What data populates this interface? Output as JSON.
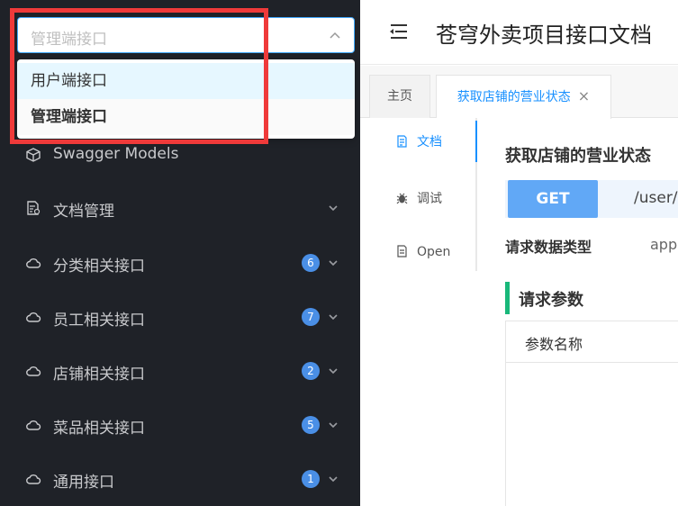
{
  "sidebar": {
    "select": {
      "value": "管理端接口",
      "options": [
        "用户端接口",
        "管理端接口"
      ]
    },
    "items": [
      {
        "label": "Swagger Models",
        "icon": "cube-icon",
        "badge": "",
        "partial": true
      },
      {
        "label": "文档管理",
        "icon": "document-settings-icon",
        "badge": ""
      },
      {
        "label": "分类相关接口",
        "icon": "cloud-icon",
        "badge": "6"
      },
      {
        "label": "员工相关接口",
        "icon": "cloud-icon",
        "badge": "7"
      },
      {
        "label": "店铺相关接口",
        "icon": "cloud-icon",
        "badge": "2"
      },
      {
        "label": "菜品相关接口",
        "icon": "cloud-icon",
        "badge": "5"
      },
      {
        "label": "通用接口",
        "icon": "cloud-icon",
        "badge": "1"
      }
    ]
  },
  "header": {
    "title": "苍穹外卖项目接口文档",
    "fold_icon": "menu-fold-icon"
  },
  "tabs": [
    {
      "label": "主页"
    },
    {
      "label": "获取店铺的营业状态",
      "close": "×"
    }
  ],
  "side_tabs": [
    {
      "label": "文档",
      "icon": "file-icon"
    },
    {
      "label": "调试",
      "icon": "bug-icon"
    },
    {
      "label": "Open",
      "icon": "page-icon"
    }
  ],
  "doc": {
    "title": "获取店铺的营业状态",
    "method": "GET",
    "path": "/user/s",
    "request_type_label": "请求数据类型",
    "request_type_value": "appl",
    "params_title": "请求参数",
    "params_header": "参数名称"
  },
  "colors": {
    "sidebar_bg": "#1f2228",
    "accent": "#1890ff",
    "badge": "#4a8fe6",
    "highlight": "#ef3a3a",
    "section_bar": "#19b87a"
  }
}
